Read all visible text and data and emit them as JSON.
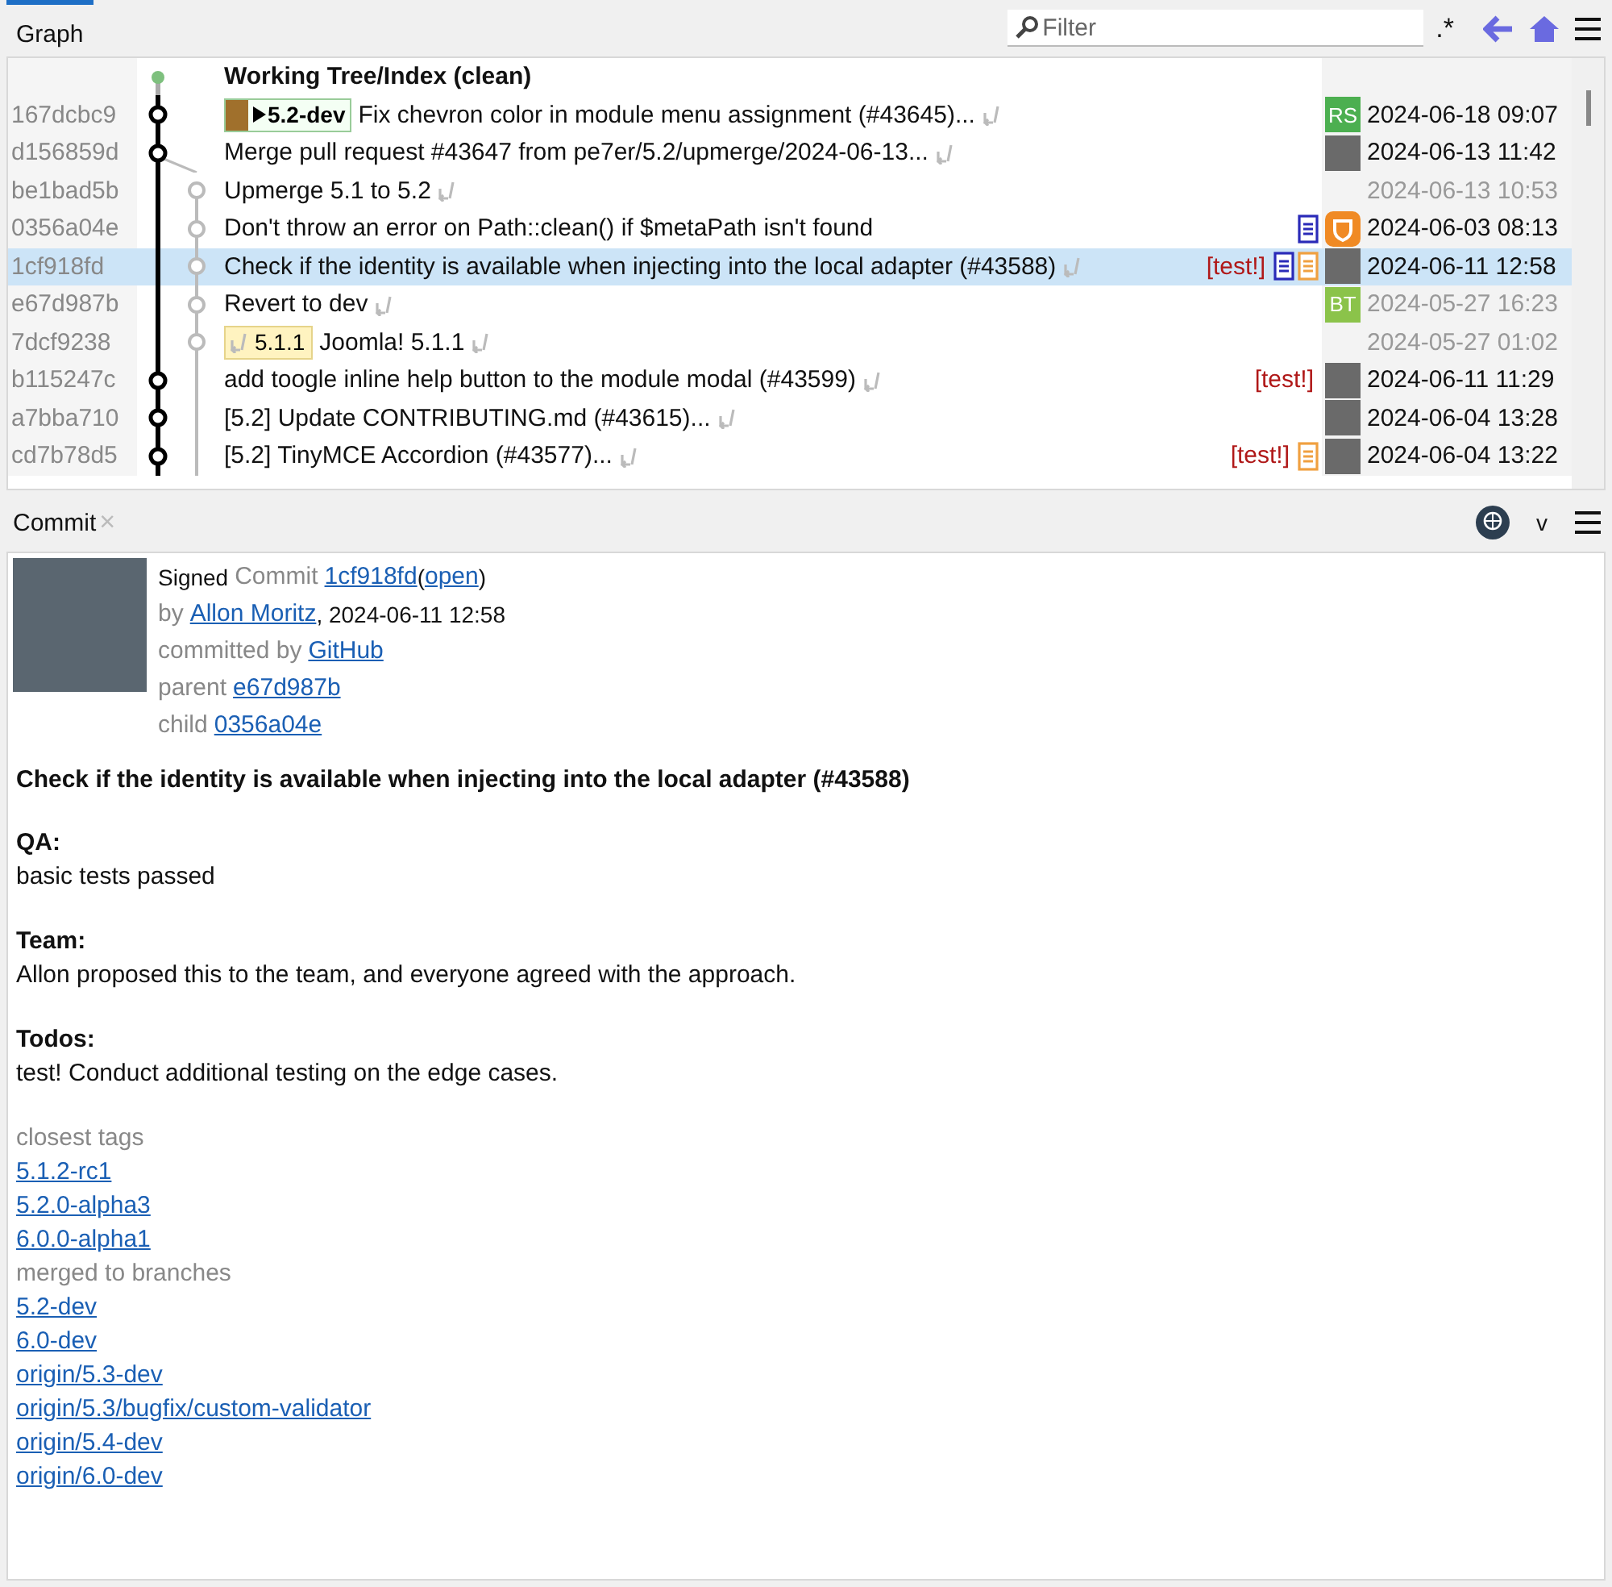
{
  "graph_tab": {
    "label": "Graph",
    "selected": true
  },
  "filter": {
    "placeholder": "Filter",
    "regex": ".*"
  },
  "rows": [
    {
      "kind": "worktree",
      "message": "Working Tree/Index (clean)",
      "bold": true,
      "continued": false,
      "selected": false
    },
    {
      "hash": "167dcbc9",
      "kind": "main",
      "bold": false,
      "branch": "5.2-dev",
      "message": "Fix chevron color in module menu assignment (#43645)...",
      "continued": true,
      "selected": false,
      "avatar": {
        "kind": "initials",
        "text": "RS",
        "color": "#4caf50"
      },
      "date": "2024-06-18 09:07",
      "dimmed": false
    },
    {
      "hash": "d156859d",
      "kind": "main",
      "bold": false,
      "message": "Merge pull request #43647 from pe7er/5.2/upmerge/2024-06-13...",
      "continued": true,
      "selected": false,
      "avatar": {
        "kind": "photo"
      },
      "date": "2024-06-13 11:42",
      "dimmed": false
    },
    {
      "hash": "be1bad5b",
      "kind": "side",
      "bold": false,
      "message": "Upmerge 5.1 to 5.2",
      "continued": true,
      "selected": false,
      "date": "2024-06-13 10:53",
      "dimmed": true
    },
    {
      "hash": "0356a04e",
      "kind": "side",
      "bold": false,
      "message": "Don't throw an error on Path::clean() if $metaPath isn't found",
      "continued": false,
      "selected": false,
      "markers": [
        {
          "color": "#2a2ab8"
        }
      ],
      "avatar": {
        "kind": "logo"
      },
      "date": "2024-06-03 08:13",
      "dimmed": false
    },
    {
      "hash": "1cf918fd",
      "kind": "side",
      "bold": false,
      "message": "Check if the identity is available when injecting into the local adapter (#43588)",
      "continued": true,
      "selected": true,
      "test": "[test!]",
      "markers": [
        {
          "color": "#2a2ab8"
        },
        {
          "color": "#f0a040"
        }
      ],
      "avatar": {
        "kind": "photo"
      },
      "date": "2024-06-11 12:58",
      "dimmed": false
    },
    {
      "hash": "e67d987b",
      "kind": "side",
      "bold": false,
      "message": "Revert to dev",
      "continued": true,
      "selected": false,
      "avatar": {
        "kind": "initials",
        "text": "BT",
        "color": "#8bc34a"
      },
      "date": "2024-05-27 16:23",
      "dimmed": true
    },
    {
      "hash": "7dcf9238",
      "kind": "side",
      "bold": false,
      "tag": "5.1.1",
      "message": "Joomla! 5.1.1",
      "continued": true,
      "selected": false,
      "date": "2024-05-27 01:02",
      "dimmed": true
    },
    {
      "hash": "b115247c",
      "kind": "main",
      "bold": false,
      "message": "add toogle inline help button to the module modal (#43599)",
      "continued": true,
      "selected": false,
      "test": "[test!]",
      "avatar": {
        "kind": "photo"
      },
      "date": "2024-06-11 11:29",
      "dimmed": false
    },
    {
      "hash": "a7bba710",
      "kind": "main",
      "bold": false,
      "message": "[5.2] Update CONTRIBUTING.md (#43615)...",
      "continued": true,
      "selected": false,
      "avatar": {
        "kind": "photo"
      },
      "date": "2024-06-04 13:28",
      "dimmed": false
    },
    {
      "hash": "cd7b78d5",
      "kind": "main",
      "bold": false,
      "message": "[5.2] TinyMCE Accordion (#43577)...",
      "continued": true,
      "selected": false,
      "test": "[test!]",
      "markers": [
        {
          "color": "#f0a040"
        }
      ],
      "avatar": {
        "kind": "photo"
      },
      "date": "2024-06-04 13:22",
      "dimmed": false
    }
  ],
  "commit_tab": {
    "label": "Commit",
    "close": "×",
    "selected": true
  },
  "commit_menu": {
    "caret": "v"
  },
  "meta": [
    [
      {
        "text": "Signed",
        "kind": "plain"
      },
      {
        "text": "Commit",
        "kind": "muted"
      },
      {
        "text": "1cf918fd",
        "kind": "link"
      },
      {
        "text": "(",
        "kind": "plain",
        "tight": true
      },
      {
        "text": "open",
        "kind": "link",
        "tight": true
      },
      {
        "text": ")",
        "kind": "plain",
        "tight": true
      }
    ],
    [
      {
        "text": "by",
        "kind": "muted"
      },
      {
        "text": "Allon Moritz",
        "kind": "link"
      },
      {
        "text": ", 2024-06-11 12:58",
        "kind": "plain",
        "tight": true
      }
    ],
    [
      {
        "text": "committed by",
        "kind": "muted"
      },
      {
        "text": "GitHub",
        "kind": "link"
      }
    ],
    [
      {
        "text": "parent",
        "kind": "muted"
      },
      {
        "text": "e67d987b",
        "kind": "link"
      }
    ],
    [
      {
        "text": "child",
        "kind": "muted"
      },
      {
        "text": "0356a04e",
        "kind": "link"
      }
    ]
  ],
  "title": "Check if the identity is available when injecting into the local adapter (#43588)",
  "sections": [
    {
      "heading": "QA:",
      "text": "basic tests passed"
    },
    {
      "heading": "Team:",
      "text": "Allon proposed this to the team, and everyone agreed with the approach."
    },
    {
      "heading": "Todos:",
      "text": "test! Conduct additional testing on the edge cases."
    }
  ],
  "link_groups": [
    {
      "label": "closest tags",
      "links": [
        "5.1.2-rc1",
        "5.2.0-alpha3",
        "6.0.0-alpha1"
      ]
    },
    {
      "label": "merged to branches",
      "links": [
        "5.2-dev",
        "6.0-dev",
        "origin/5.3-dev",
        "origin/5.3/bugfix/custom-validator",
        "origin/5.4-dev",
        "origin/6.0-dev"
      ]
    }
  ]
}
